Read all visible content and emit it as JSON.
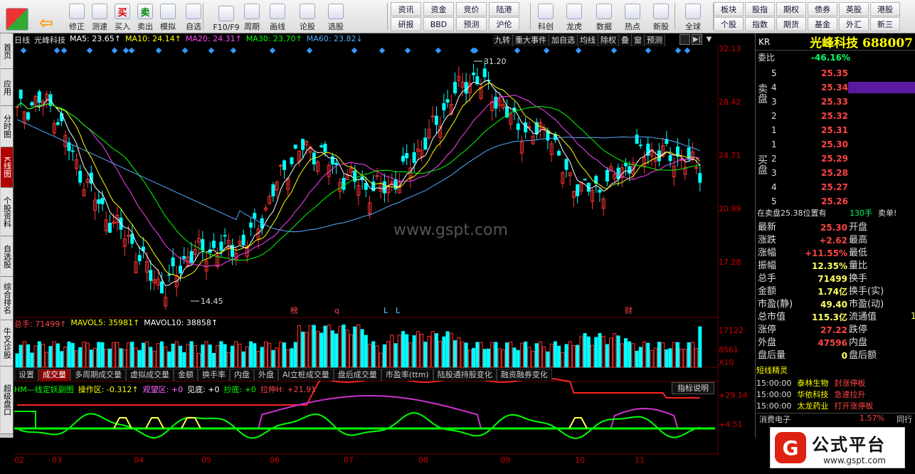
{
  "toolbar": {
    "buttons1": [
      {
        "label": "",
        "icon": "grid-logo-icon"
      },
      {
        "label": "",
        "icon": "back-arrow-icon"
      },
      {
        "label": "修正",
        "icon": "up-down-icon"
      },
      {
        "label": "测速",
        "icon": "speed-icon"
      },
      {
        "label": "买入",
        "icon": "buy-icon",
        "glyph": "买"
      },
      {
        "label": "卖出",
        "icon": "sell-icon",
        "glyph": "卖"
      },
      {
        "label": "模拟",
        "icon": "hammer-icon"
      },
      {
        "label": "自选",
        "icon": "star-icon"
      },
      {
        "label": "F10/F9",
        "icon": "f10-icon"
      },
      {
        "label": "周期",
        "icon": "clock-icon"
      },
      {
        "label": "画线",
        "icon": "pen-icon"
      },
      {
        "label": "论股",
        "icon": "discuss-icon"
      },
      {
        "label": "选股",
        "icon": "filter-icon"
      }
    ],
    "grid1": [
      "资讯",
      "资金",
      "竞价",
      "陆港",
      "研报",
      "BBD",
      "预测",
      "沪伦"
    ],
    "buttons2": [
      {
        "label": "科创",
        "icon": "kechuang-icon"
      },
      {
        "label": "龙虎",
        "icon": "dragon-icon"
      },
      {
        "label": "数据",
        "icon": "pe-icon"
      },
      {
        "label": "热点",
        "icon": "hot-icon"
      },
      {
        "label": "新股",
        "icon": "ipo-icon"
      },
      {
        "label": "全球",
        "icon": "globe-icon"
      }
    ],
    "grid2": [
      "板块",
      "股指",
      "期权",
      "债券",
      "英股",
      "港股",
      "个股",
      "指数",
      "期货",
      "基金",
      "外汇",
      "新三"
    ]
  },
  "left_tabs": [
    {
      "label": "首页",
      "active": false
    },
    {
      "label": "应用",
      "active": false
    },
    {
      "label": "分时图",
      "active": false
    },
    {
      "label": "K线图",
      "active": true
    },
    {
      "label": "个股资料",
      "active": false
    },
    {
      "label": "自选股",
      "active": false
    },
    {
      "label": "综合排名",
      "active": false
    },
    {
      "label": "牛叉诊股",
      "active": false
    },
    {
      "label": "超级盘口",
      "active": false
    }
  ],
  "chart": {
    "period": "日线",
    "stock": "光峰科技",
    "ma": [
      {
        "label": "MA5: 23.65↑",
        "color": "#ffffff"
      },
      {
        "label": "MA10: 24.14↑",
        "color": "#ffff00"
      },
      {
        "label": "MA20: 24.31↑",
        "color": "#ff44ff"
      },
      {
        "label": "MA30: 23.70↑",
        "color": "#00ff00"
      },
      {
        "label": "MA60: 23.82↓",
        "color": "#55aaff"
      }
    ],
    "right_tabs": [
      "九转",
      "重大事件",
      "加自选",
      "均线",
      "除权",
      "叠",
      "窗",
      "预测"
    ],
    "price_axis": [
      "32.13",
      "28.42",
      "24.71",
      "20.99",
      "17.28"
    ],
    "high_label": "31.20",
    "low_label": "14.45",
    "event_markers": [
      {
        "text": "榜",
        "color": "#ff4444"
      },
      {
        "text": "q",
        "color": "#ff4444"
      },
      {
        "text": "L",
        "color": "#55ccff"
      },
      {
        "text": "L",
        "color": "#55ccff"
      },
      {
        "text": "财",
        "color": "#ff4444"
      }
    ],
    "watermark": "www.gspt.com",
    "months": [
      "02",
      "03",
      "04",
      "05",
      "06",
      "07",
      "08",
      "09",
      "10",
      "11"
    ]
  },
  "volume": {
    "total_label": "总手: 71499↑",
    "mavol5": "MAVOL5: 35981↑",
    "mavol10": "MAVOL10: 38858↑",
    "axis": [
      "17122",
      "8561",
      "X10"
    ]
  },
  "indicator_tabs": [
    "设置",
    "成交量",
    "多周期成交量",
    "虚拟成交量",
    "金额",
    "换手率",
    "内盘",
    "外盘",
    "AI立桩成交量",
    "盘后成交量",
    "市盈率(ttm)",
    "陆股通持股变化",
    "融资融券变化"
  ],
  "hm": {
    "title": "HM—线定妖副图",
    "caozuo": "操作区: -0.312↑",
    "guanwang": "观望区: +0",
    "jiandi": "见底: +0",
    "chaodi": "抄底: +0",
    "lashen": "拉伸H: +21.91",
    "help": "指标说明",
    "axis": [
      "+29.14",
      "+4.51"
    ]
  },
  "quote": {
    "code": "KR",
    "name": "光峰科技 688007",
    "weibi_label": "委比",
    "weibi": "-46.16%",
    "sell_label": "卖盘",
    "buy_label": "买盘",
    "asks": [
      {
        "lvl": "5",
        "price": "25.35",
        "vol": ""
      },
      {
        "lvl": "4",
        "price": "25.34",
        "vol": ""
      },
      {
        "lvl": "3",
        "price": "25.33",
        "vol": ""
      },
      {
        "lvl": "2",
        "price": "25.32",
        "vol": ""
      },
      {
        "lvl": "1",
        "price": "25.31",
        "vol": ""
      }
    ],
    "bids": [
      {
        "lvl": "1",
        "price": "25.30",
        "vol": ""
      },
      {
        "lvl": "2",
        "price": "25.29",
        "vol": ""
      },
      {
        "lvl": "3",
        "price": "25.28",
        "vol": ""
      },
      {
        "lvl": "4",
        "price": "25.27",
        "vol": ""
      },
      {
        "lvl": "5",
        "price": "25.26",
        "vol": ""
      }
    ],
    "position_note": "在卖盘25.38位置有",
    "position_vol": "130手",
    "position_end": "卖单!",
    "stats": [
      {
        "l": "最新",
        "v": "25.30",
        "r": "开盘",
        "vc": "#ff4444"
      },
      {
        "l": "涨跌",
        "v": "+2.62",
        "r": "最高",
        "vc": "#ff4444"
      },
      {
        "l": "涨幅",
        "v": "+11.55%",
        "r": "最低",
        "vc": "#ff4444"
      },
      {
        "l": "振幅",
        "v": "12.35%",
        "r": "量比",
        "vc": "#ffff66"
      },
      {
        "l": "总手",
        "v": "71499",
        "r": "换手",
        "vc": "#ffff66"
      },
      {
        "l": "金额",
        "v": "1.74亿",
        "r": "换手(实)",
        "vc": "#ffff66"
      },
      {
        "l": "市盈(静)",
        "v": "49.40",
        "r": "市盈(动)",
        "vc": "#ffff66"
      },
      {
        "l": "总市值",
        "v": "115.3亿",
        "r": "流通值",
        "vc": "#ffff66"
      },
      {
        "l": "涨停",
        "v": "27.22",
        "r": "跌停",
        "vc": "#ff4444"
      },
      {
        "l": "外盘",
        "v": "47596",
        "r": "内盘",
        "vc": "#ff4444"
      },
      {
        "l": "盘后量",
        "v": "0",
        "r": "盘后额",
        "vc": "#ffff66"
      }
    ],
    "stat_right_extra": "1"
  },
  "news": {
    "title": "短线精灵",
    "items": [
      {
        "time": "15:00:00",
        "name": "泰林生物",
        "event": "封涨停板"
      },
      {
        "time": "15:00:00",
        "name": "华依科技",
        "event": "急速拉升"
      },
      {
        "time": "15:00:00",
        "name": "太龙药业",
        "event": "打开涨停板"
      }
    ]
  },
  "bottom_strip": {
    "label": "消费电子",
    "value": "1.57%",
    "right": "同行"
  },
  "logo": {
    "glyph": "G",
    "name": "公式平台",
    "url": "www.gspt.com"
  },
  "colors": {
    "up": "#ff3333",
    "down": "#00ffff",
    "axis": "#cc0000",
    "bg": "#000000"
  }
}
